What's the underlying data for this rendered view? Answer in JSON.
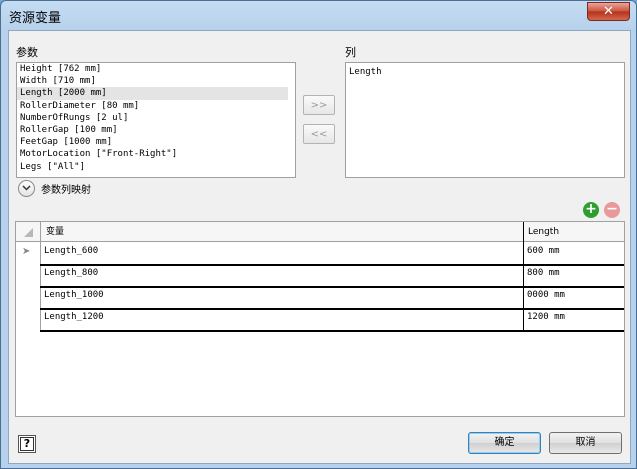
{
  "window": {
    "title": "资源变量",
    "close_glyph": "✕"
  },
  "params": {
    "label": "参数",
    "items": [
      "Height [762 mm]",
      "Width [710 mm]",
      "Length [2000 mm]",
      "RollerDiameter [80 mm]",
      "NumberOfRungs [2 ul]",
      "RollerGap [100 mm]",
      "FeetGap [1000 mm]",
      "MotorLocation [\"Front-Right\"]",
      "Legs [\"All\"]"
    ],
    "selected_index": 2
  },
  "columns": {
    "label": "列",
    "items": [
      "Length"
    ]
  },
  "move_buttons": {
    "add": ">>",
    "remove": "<<"
  },
  "mapping_toggle": {
    "label": "参数列映射"
  },
  "grid": {
    "headers": [
      "变量",
      "Length"
    ],
    "rows": [
      {
        "name": "Length_600",
        "value": "600 mm"
      },
      {
        "name": "Length_800",
        "value": "800 mm"
      },
      {
        "name": "Length_1000",
        "value": "0000 mm"
      },
      {
        "name": "Length_1200",
        "value": "1200 mm"
      }
    ],
    "current_row_glyph": "➤"
  },
  "row_actions": {
    "add_glyph": "+",
    "remove_glyph": "−",
    "add_color": "#2f9e2f",
    "remove_color": "#e89a9a"
  },
  "footer": {
    "help": "?",
    "ok": "确定",
    "cancel": "取消"
  }
}
